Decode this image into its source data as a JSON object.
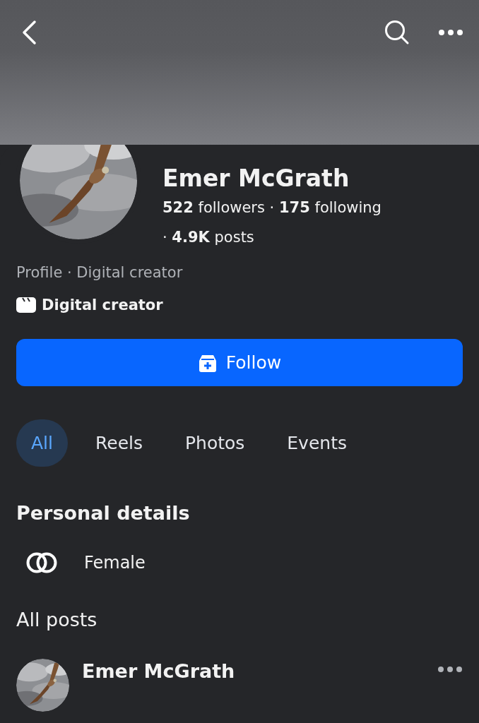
{
  "profile": {
    "name": "Emer McGrath",
    "stats": "**522** followers · **175** following",
    "posts_stat": "· **4.9K** posts",
    "subtitle": "Profile · Digital creator",
    "category": "Digital creator"
  },
  "follow_button": {
    "label": "Follow"
  },
  "tabs": [
    {
      "label": "All",
      "selected": true
    },
    {
      "label": "Reels",
      "selected": false
    },
    {
      "label": "Photos",
      "selected": false
    },
    {
      "label": "Events",
      "selected": false
    }
  ],
  "personal_details": {
    "title": "Personal details",
    "items": [
      {
        "kind": "gender",
        "text": "Female"
      }
    ]
  },
  "posts": {
    "title": "All posts",
    "items": [
      {
        "author": "Emer McGrath"
      }
    ]
  }
}
